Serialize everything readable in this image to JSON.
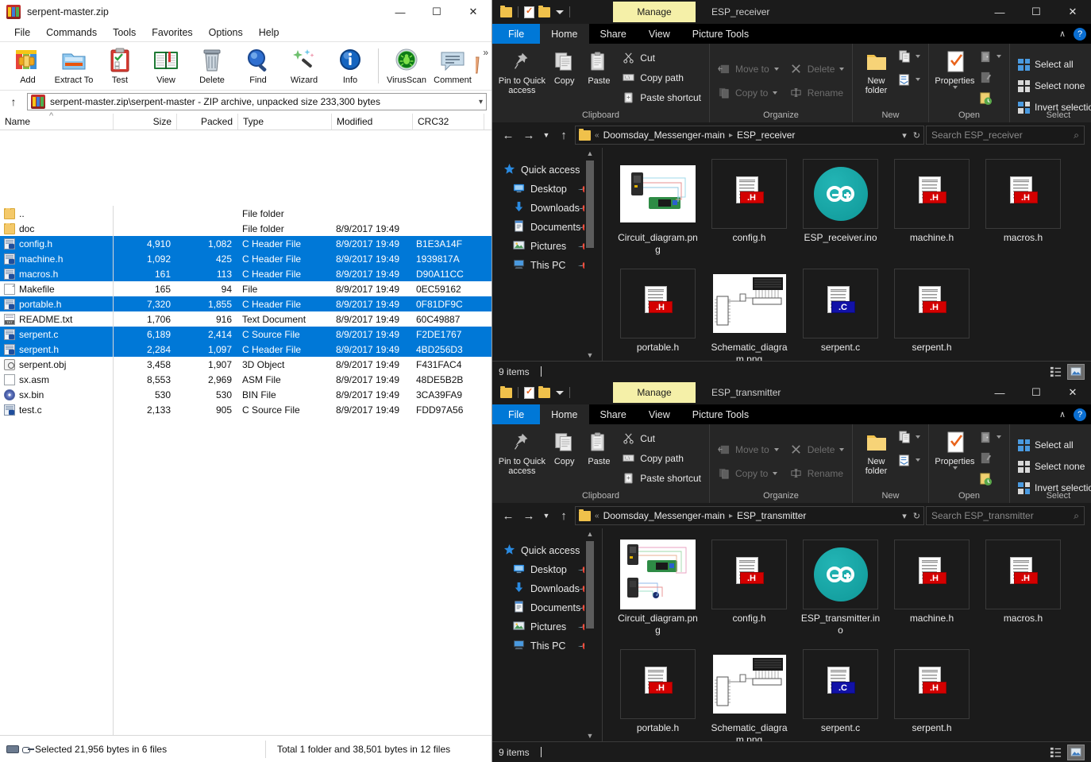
{
  "winrar": {
    "title": "serpent-master.zip",
    "window_buttons": [
      "—",
      "☐",
      "✕"
    ],
    "menu": [
      "File",
      "Commands",
      "Tools",
      "Favorites",
      "Options",
      "Help"
    ],
    "toolbar": [
      {
        "label": "Add",
        "icon": "add-icon"
      },
      {
        "label": "Extract To",
        "icon": "extract-to-icon"
      },
      {
        "label": "Test",
        "icon": "test-icon"
      },
      {
        "label": "View",
        "icon": "view-icon"
      },
      {
        "label": "Delete",
        "icon": "delete-icon"
      },
      {
        "label": "Find",
        "icon": "find-icon"
      },
      {
        "label": "Wizard",
        "icon": "wizard-icon"
      },
      {
        "label": "Info",
        "icon": "info-icon"
      },
      {
        "label": "VirusScan",
        "icon": "virusscan-icon"
      },
      {
        "label": "Comment",
        "icon": "comment-icon"
      }
    ],
    "toolbar_overflow": "»",
    "address": "serpent-master.zip\\serpent-master - ZIP archive, unpacked size 233,300 bytes",
    "columns": [
      "Name",
      "Size",
      "Packed",
      "Type",
      "Modified",
      "CRC32"
    ],
    "rows": [
      {
        "name": "..",
        "size": "",
        "packed": "",
        "type": "File folder",
        "modified": "",
        "crc": "",
        "icon": "folder",
        "selected": false
      },
      {
        "name": "doc",
        "size": "",
        "packed": "",
        "type": "File folder",
        "modified": "8/9/2017 19:49",
        "crc": "",
        "icon": "folder",
        "selected": false
      },
      {
        "name": "config.h",
        "size": "4,910",
        "packed": "1,082",
        "type": "C Header File",
        "modified": "8/9/2017 19:49",
        "crc": "B1E3A14F",
        "icon": "h",
        "selected": true
      },
      {
        "name": "machine.h",
        "size": "1,092",
        "packed": "425",
        "type": "C Header File",
        "modified": "8/9/2017 19:49",
        "crc": "1939817A",
        "icon": "h",
        "selected": true
      },
      {
        "name": "macros.h",
        "size": "161",
        "packed": "113",
        "type": "C Header File",
        "modified": "8/9/2017 19:49",
        "crc": "D90A11CC",
        "icon": "h",
        "selected": true
      },
      {
        "name": "Makefile",
        "size": "165",
        "packed": "94",
        "type": "File",
        "modified": "8/9/2017 19:49",
        "crc": "0EC59162",
        "icon": "plain",
        "selected": false
      },
      {
        "name": "portable.h",
        "size": "7,320",
        "packed": "1,855",
        "type": "C Header File",
        "modified": "8/9/2017 19:49",
        "crc": "0F81DF9C",
        "icon": "h",
        "selected": true
      },
      {
        "name": "README.txt",
        "size": "1,706",
        "packed": "916",
        "type": "Text Document",
        "modified": "8/9/2017 19:49",
        "crc": "60C49887",
        "icon": "txt",
        "selected": false
      },
      {
        "name": "serpent.c",
        "size": "6,189",
        "packed": "2,414",
        "type": "C Source File",
        "modified": "8/9/2017 19:49",
        "crc": "F2DE1767",
        "icon": "c",
        "selected": true
      },
      {
        "name": "serpent.h",
        "size": "2,284",
        "packed": "1,097",
        "type": "C Header File",
        "modified": "8/9/2017 19:49",
        "crc": "4BD256D3",
        "icon": "h",
        "selected": true
      },
      {
        "name": "serpent.obj",
        "size": "3,458",
        "packed": "1,907",
        "type": "3D Object",
        "modified": "8/9/2017 19:49",
        "crc": "F431FAC4",
        "icon": "obj",
        "selected": false
      },
      {
        "name": "sx.asm",
        "size": "8,553",
        "packed": "2,969",
        "type": "ASM File",
        "modified": "8/9/2017 19:49",
        "crc": "48DE5B2B",
        "icon": "asm",
        "selected": false
      },
      {
        "name": "sx.bin",
        "size": "530",
        "packed": "530",
        "type": "BIN File",
        "modified": "8/9/2017 19:49",
        "crc": "3CA39FA9",
        "icon": "bin",
        "selected": false
      },
      {
        "name": "test.c",
        "size": "2,133",
        "packed": "905",
        "type": "C Source File",
        "modified": "8/9/2017 19:49",
        "crc": "FDD97A56",
        "icon": "c",
        "selected": false
      }
    ],
    "status_selected": "Selected 21,956 bytes in 6 files",
    "status_total": "Total 1 folder and 38,501 bytes in 12 files"
  },
  "ribbon": {
    "manage_tab": "Manage",
    "tabs": [
      "File",
      "Home",
      "Share",
      "View",
      "Picture Tools"
    ],
    "help_glyph": "?",
    "collapse_glyph": "∧",
    "groups": [
      {
        "title": "Clipboard",
        "big": [
          {
            "label": "Pin to Quick access",
            "icon": "pin-icon"
          },
          {
            "label": "Copy",
            "icon": "copy-icon"
          },
          {
            "label": "Paste",
            "icon": "paste-icon"
          }
        ],
        "small": [
          {
            "label": "Cut",
            "icon": "cut-icon",
            "dim": false
          },
          {
            "label": "Copy path",
            "icon": "copy-path-icon",
            "dim": false
          },
          {
            "label": "Paste shortcut",
            "icon": "paste-shortcut-icon",
            "dim": false
          }
        ]
      },
      {
        "title": "Organize",
        "small": [
          {
            "label": "Move to",
            "icon": "move-to-icon",
            "dim": true,
            "caret": true
          },
          {
            "label": "Copy to",
            "icon": "copy-to-icon",
            "dim": true,
            "caret": true
          }
        ],
        "small2": [
          {
            "label": "Delete",
            "icon": "delete-icon",
            "dim": true,
            "caret": true
          },
          {
            "label": "Rename",
            "icon": "rename-icon",
            "dim": true,
            "caret": false
          }
        ]
      },
      {
        "title": "New",
        "big": [
          {
            "label": "New folder",
            "icon": "new-folder-icon"
          }
        ],
        "stack": [
          "new-item-icon",
          "easy-access-icon"
        ]
      },
      {
        "title": "Open",
        "big": [
          {
            "label": "Properties",
            "icon": "properties-icon",
            "caret": true
          }
        ],
        "stack": [
          "open-with-icon",
          "edit-icon",
          "history-icon"
        ]
      },
      {
        "title": "Select",
        "small": [
          {
            "label": "Select all",
            "icon": "select-all-icon"
          },
          {
            "label": "Select none",
            "icon": "select-none-icon"
          },
          {
            "label": "Invert selection",
            "icon": "invert-selection-icon"
          }
        ]
      }
    ]
  },
  "navpane": {
    "items": [
      {
        "label": "Quick access",
        "icon": "star-icon",
        "pinned": false,
        "root": true
      },
      {
        "label": "Desktop",
        "icon": "desktop-icon",
        "pinned": true
      },
      {
        "label": "Downloads",
        "icon": "downloads-icon",
        "pinned": true
      },
      {
        "label": "Documents",
        "icon": "documents-icon",
        "pinned": true
      },
      {
        "label": "Pictures",
        "icon": "pictures-icon",
        "pinned": true
      },
      {
        "label": "This PC",
        "icon": "this-pc-icon",
        "pinned": true
      }
    ]
  },
  "receiver": {
    "window_title": "ESP_receiver",
    "window_buttons": [
      "—",
      "☐",
      "✕"
    ],
    "breadcrumb": {
      "overflow": "«",
      "parts": [
        "Doomsday_Messenger-main",
        "ESP_receiver"
      ]
    },
    "search_placeholder": "Search ESP_receiver",
    "files": [
      {
        "name": "Circuit_diagram.png",
        "icon": "photo-circuit"
      },
      {
        "name": "config.h",
        "icon": "h-doc"
      },
      {
        "name": "ESP_receiver.ino",
        "icon": "arduino"
      },
      {
        "name": "machine.h",
        "icon": "h-doc"
      },
      {
        "name": "macros.h",
        "icon": "h-doc"
      },
      {
        "name": "portable.h",
        "icon": "h-doc"
      },
      {
        "name": "Schematic_diagram.png",
        "icon": "photo-schematic"
      },
      {
        "name": "serpent.c",
        "icon": "c-doc"
      },
      {
        "name": "serpent.h",
        "icon": "h-doc"
      }
    ],
    "status": "9 items"
  },
  "transmitter": {
    "window_title": "ESP_transmitter",
    "window_buttons": [
      "—",
      "☐",
      "✕"
    ],
    "breadcrumb": {
      "overflow": "«",
      "parts": [
        "Doomsday_Messenger-main",
        "ESP_transmitter"
      ]
    },
    "search_placeholder": "Search ESP_transmitter",
    "files": [
      {
        "name": "Circuit_diagram.png",
        "icon": "photo-circuit"
      },
      {
        "name": "config.h",
        "icon": "h-doc"
      },
      {
        "name": "ESP_transmitter.ino",
        "icon": "arduino"
      },
      {
        "name": "machine.h",
        "icon": "h-doc"
      },
      {
        "name": "macros.h",
        "icon": "h-doc"
      },
      {
        "name": "portable.h",
        "icon": "h-doc"
      },
      {
        "name": "Schematic_diagram.png",
        "icon": "photo-schematic"
      },
      {
        "name": "serpent.c",
        "icon": "c-doc"
      },
      {
        "name": "serpent.h",
        "icon": "h-doc"
      }
    ],
    "status": "9 items"
  },
  "colors": {
    "accent_blue": "#0078d7",
    "manage_yellow": "#f5f0a8",
    "arduino_teal": "#0f9898",
    "badge_h_red": "#d40000",
    "badge_c_blue": "#1212a8",
    "selection_blue": "#0078d7"
  }
}
